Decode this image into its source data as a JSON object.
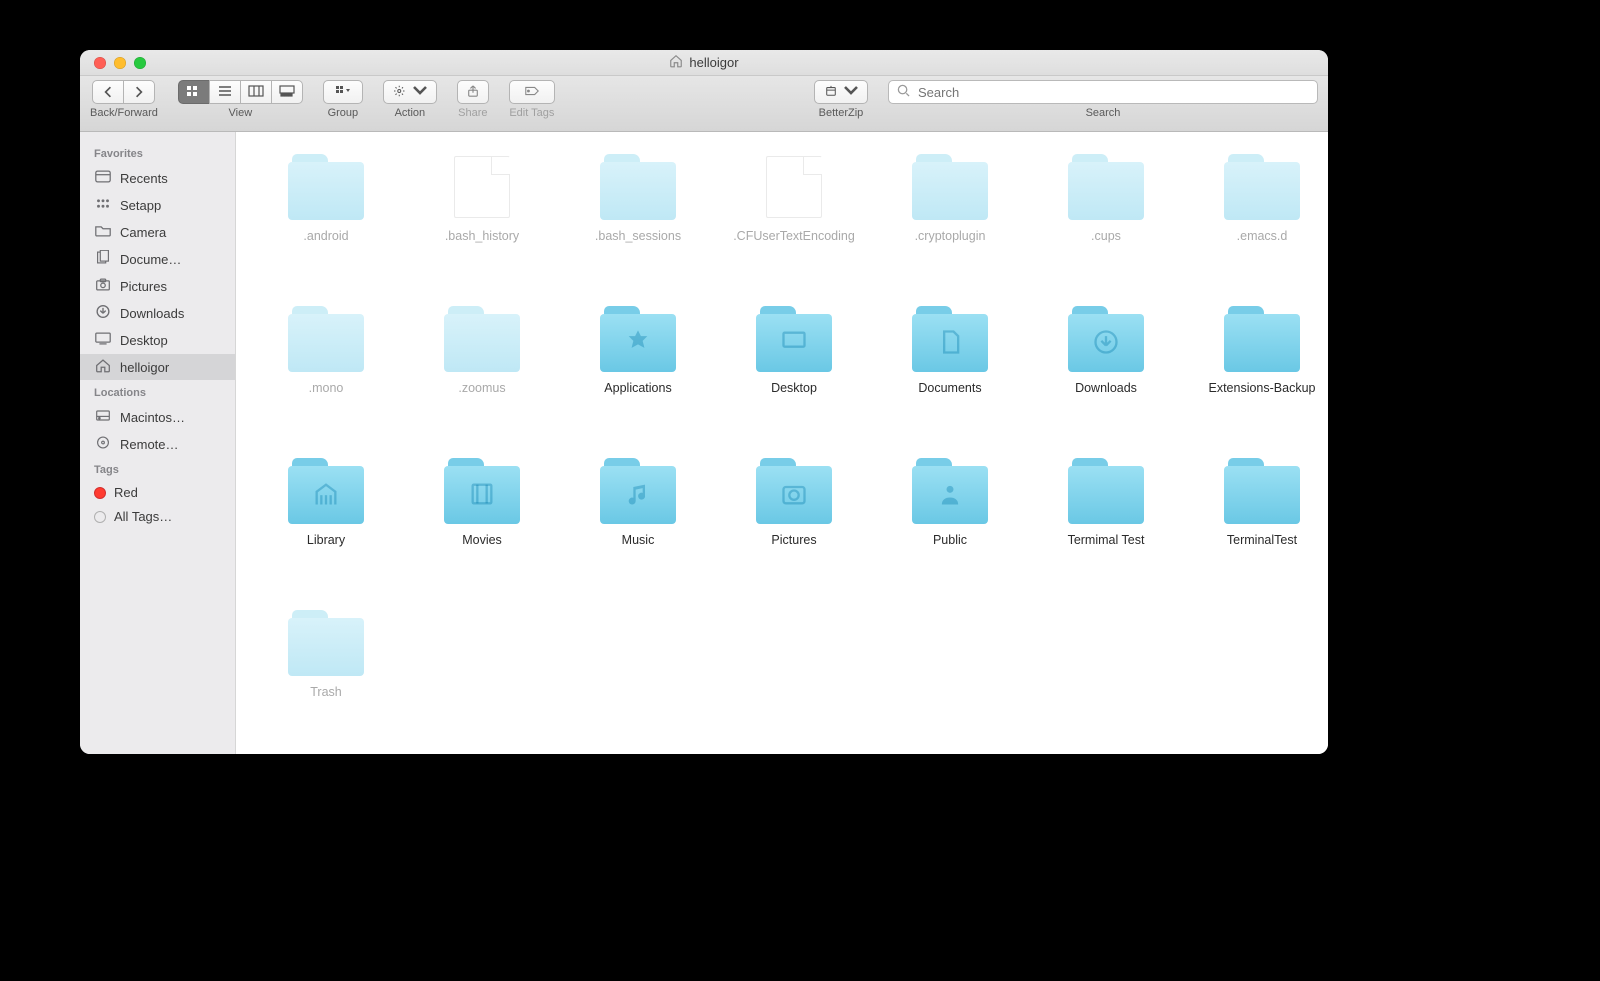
{
  "window": {
    "title": "helloigor"
  },
  "toolbar": {
    "back_forward": "Back/Forward",
    "view": "View",
    "group": "Group",
    "action": "Action",
    "share": "Share",
    "edit_tags": "Edit Tags",
    "betterzip": "BetterZip",
    "search": "Search",
    "search_placeholder": "Search"
  },
  "sidebar": {
    "favorites_label": "Favorites",
    "favorites": [
      {
        "icon": "recents",
        "label": "Recents"
      },
      {
        "icon": "setapp",
        "label": "Setapp"
      },
      {
        "icon": "folder",
        "label": "Camera"
      },
      {
        "icon": "documents",
        "label": "Docume…"
      },
      {
        "icon": "pictures",
        "label": "Pictures"
      },
      {
        "icon": "downloads",
        "label": "Downloads"
      },
      {
        "icon": "desktop",
        "label": "Desktop"
      },
      {
        "icon": "home",
        "label": "helloigor",
        "selected": true
      }
    ],
    "locations_label": "Locations",
    "locations": [
      {
        "icon": "hdd",
        "label": "Macintos…"
      },
      {
        "icon": "disc",
        "label": "Remote…"
      }
    ],
    "tags_label": "Tags",
    "tags": [
      {
        "color": "red",
        "label": "Red"
      },
      {
        "color": "none",
        "label": "All Tags…"
      }
    ]
  },
  "items": [
    {
      "type": "folder",
      "label": ".android",
      "hidden": true
    },
    {
      "type": "file",
      "label": ".bash_history",
      "hidden": true
    },
    {
      "type": "folder",
      "label": ".bash_sessions",
      "hidden": true
    },
    {
      "type": "file",
      "label": ".CFUserTextEncoding",
      "hidden": true
    },
    {
      "type": "folder",
      "label": ".cryptoplugin",
      "hidden": true
    },
    {
      "type": "folder",
      "label": ".cups",
      "hidden": true
    },
    {
      "type": "folder",
      "label": ".emacs.d",
      "hidden": true
    },
    {
      "type": "folder",
      "label": ".mono",
      "hidden": true
    },
    {
      "type": "folder",
      "label": ".zoomus",
      "hidden": true
    },
    {
      "type": "folder",
      "label": "Applications",
      "glyph": "app"
    },
    {
      "type": "folder",
      "label": "Desktop",
      "glyph": "desktop"
    },
    {
      "type": "folder",
      "label": "Documents",
      "glyph": "doc"
    },
    {
      "type": "folder",
      "label": "Downloads",
      "glyph": "download"
    },
    {
      "type": "folder",
      "label": "Extensions-Backup"
    },
    {
      "type": "folder",
      "label": "Library",
      "glyph": "library"
    },
    {
      "type": "folder",
      "label": "Movies",
      "glyph": "movies"
    },
    {
      "type": "folder",
      "label": "Music",
      "glyph": "music"
    },
    {
      "type": "folder",
      "label": "Pictures",
      "glyph": "pictures"
    },
    {
      "type": "folder",
      "label": "Public",
      "glyph": "public"
    },
    {
      "type": "folder",
      "label": "Termimal Test"
    },
    {
      "type": "folder",
      "label": "TerminalTest"
    },
    {
      "type": "folder",
      "label": "Trash",
      "hidden": true
    }
  ]
}
